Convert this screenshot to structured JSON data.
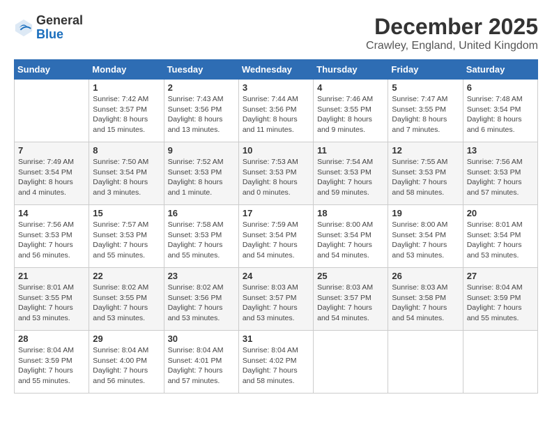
{
  "logo": {
    "general": "General",
    "blue": "Blue"
  },
  "header": {
    "month": "December 2025",
    "location": "Crawley, England, United Kingdom"
  },
  "days_of_week": [
    "Sunday",
    "Monday",
    "Tuesday",
    "Wednesday",
    "Thursday",
    "Friday",
    "Saturday"
  ],
  "weeks": [
    [
      {
        "day": "",
        "info": ""
      },
      {
        "day": "1",
        "info": "Sunrise: 7:42 AM\nSunset: 3:57 PM\nDaylight: 8 hours\nand 15 minutes."
      },
      {
        "day": "2",
        "info": "Sunrise: 7:43 AM\nSunset: 3:56 PM\nDaylight: 8 hours\nand 13 minutes."
      },
      {
        "day": "3",
        "info": "Sunrise: 7:44 AM\nSunset: 3:56 PM\nDaylight: 8 hours\nand 11 minutes."
      },
      {
        "day": "4",
        "info": "Sunrise: 7:46 AM\nSunset: 3:55 PM\nDaylight: 8 hours\nand 9 minutes."
      },
      {
        "day": "5",
        "info": "Sunrise: 7:47 AM\nSunset: 3:55 PM\nDaylight: 8 hours\nand 7 minutes."
      },
      {
        "day": "6",
        "info": "Sunrise: 7:48 AM\nSunset: 3:54 PM\nDaylight: 8 hours\nand 6 minutes."
      }
    ],
    [
      {
        "day": "7",
        "info": "Sunrise: 7:49 AM\nSunset: 3:54 PM\nDaylight: 8 hours\nand 4 minutes."
      },
      {
        "day": "8",
        "info": "Sunrise: 7:50 AM\nSunset: 3:54 PM\nDaylight: 8 hours\nand 3 minutes."
      },
      {
        "day": "9",
        "info": "Sunrise: 7:52 AM\nSunset: 3:53 PM\nDaylight: 8 hours\nand 1 minute."
      },
      {
        "day": "10",
        "info": "Sunrise: 7:53 AM\nSunset: 3:53 PM\nDaylight: 8 hours\nand 0 minutes."
      },
      {
        "day": "11",
        "info": "Sunrise: 7:54 AM\nSunset: 3:53 PM\nDaylight: 7 hours\nand 59 minutes."
      },
      {
        "day": "12",
        "info": "Sunrise: 7:55 AM\nSunset: 3:53 PM\nDaylight: 7 hours\nand 58 minutes."
      },
      {
        "day": "13",
        "info": "Sunrise: 7:56 AM\nSunset: 3:53 PM\nDaylight: 7 hours\nand 57 minutes."
      }
    ],
    [
      {
        "day": "14",
        "info": "Sunrise: 7:56 AM\nSunset: 3:53 PM\nDaylight: 7 hours\nand 56 minutes."
      },
      {
        "day": "15",
        "info": "Sunrise: 7:57 AM\nSunset: 3:53 PM\nDaylight: 7 hours\nand 55 minutes."
      },
      {
        "day": "16",
        "info": "Sunrise: 7:58 AM\nSunset: 3:53 PM\nDaylight: 7 hours\nand 55 minutes."
      },
      {
        "day": "17",
        "info": "Sunrise: 7:59 AM\nSunset: 3:54 PM\nDaylight: 7 hours\nand 54 minutes."
      },
      {
        "day": "18",
        "info": "Sunrise: 8:00 AM\nSunset: 3:54 PM\nDaylight: 7 hours\nand 54 minutes."
      },
      {
        "day": "19",
        "info": "Sunrise: 8:00 AM\nSunset: 3:54 PM\nDaylight: 7 hours\nand 53 minutes."
      },
      {
        "day": "20",
        "info": "Sunrise: 8:01 AM\nSunset: 3:54 PM\nDaylight: 7 hours\nand 53 minutes."
      }
    ],
    [
      {
        "day": "21",
        "info": "Sunrise: 8:01 AM\nSunset: 3:55 PM\nDaylight: 7 hours\nand 53 minutes."
      },
      {
        "day": "22",
        "info": "Sunrise: 8:02 AM\nSunset: 3:55 PM\nDaylight: 7 hours\nand 53 minutes."
      },
      {
        "day": "23",
        "info": "Sunrise: 8:02 AM\nSunset: 3:56 PM\nDaylight: 7 hours\nand 53 minutes."
      },
      {
        "day": "24",
        "info": "Sunrise: 8:03 AM\nSunset: 3:57 PM\nDaylight: 7 hours\nand 53 minutes."
      },
      {
        "day": "25",
        "info": "Sunrise: 8:03 AM\nSunset: 3:57 PM\nDaylight: 7 hours\nand 54 minutes."
      },
      {
        "day": "26",
        "info": "Sunrise: 8:03 AM\nSunset: 3:58 PM\nDaylight: 7 hours\nand 54 minutes."
      },
      {
        "day": "27",
        "info": "Sunrise: 8:04 AM\nSunset: 3:59 PM\nDaylight: 7 hours\nand 55 minutes."
      }
    ],
    [
      {
        "day": "28",
        "info": "Sunrise: 8:04 AM\nSunset: 3:59 PM\nDaylight: 7 hours\nand 55 minutes."
      },
      {
        "day": "29",
        "info": "Sunrise: 8:04 AM\nSunset: 4:00 PM\nDaylight: 7 hours\nand 56 minutes."
      },
      {
        "day": "30",
        "info": "Sunrise: 8:04 AM\nSunset: 4:01 PM\nDaylight: 7 hours\nand 57 minutes."
      },
      {
        "day": "31",
        "info": "Sunrise: 8:04 AM\nSunset: 4:02 PM\nDaylight: 7 hours\nand 58 minutes."
      },
      {
        "day": "",
        "info": ""
      },
      {
        "day": "",
        "info": ""
      },
      {
        "day": "",
        "info": ""
      }
    ]
  ]
}
